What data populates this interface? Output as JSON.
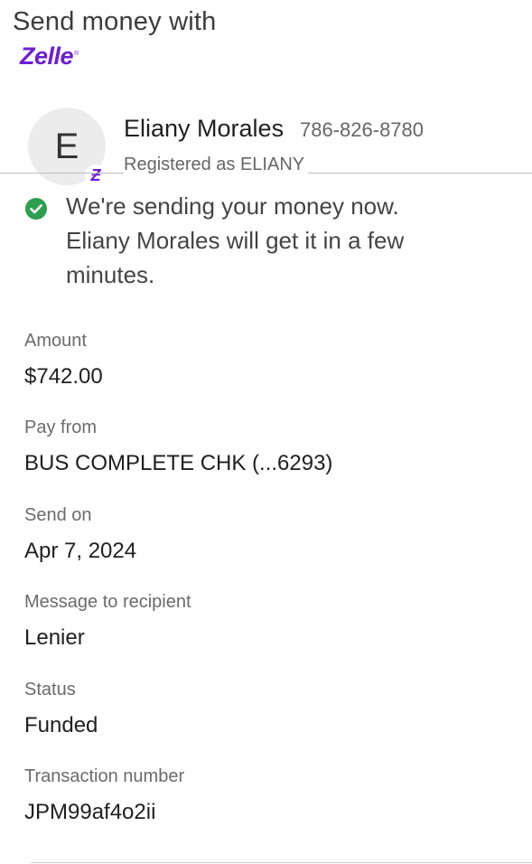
{
  "header": {
    "title": "Send money with",
    "brand": "Zelle",
    "brand_mark": "®",
    "brand_color": "#6d1ed4"
  },
  "recipient": {
    "initial": "E",
    "badge": "Ƶ",
    "name": "Eliany Morales",
    "phone": "786-826-8780",
    "registered": "Registered as ELIANY"
  },
  "status_banner": {
    "icon": "check-circle-icon",
    "icon_color": "#2e9e4f",
    "message": "We're sending your money now. Eliany Morales will get it in a few minutes."
  },
  "details": {
    "amount_label": "Amount",
    "amount_value": "$742.00",
    "pay_from_label": "Pay from",
    "pay_from_value": "BUS COMPLETE CHK (...6293)",
    "send_on_label": "Send on",
    "send_on_value": "Apr 7, 2024",
    "message_label": "Message to recipient",
    "message_value": "Lenier",
    "status_label": "Status",
    "status_value": "Funded",
    "transaction_label": "Transaction number",
    "transaction_value": "JPM99af4o2ii"
  }
}
